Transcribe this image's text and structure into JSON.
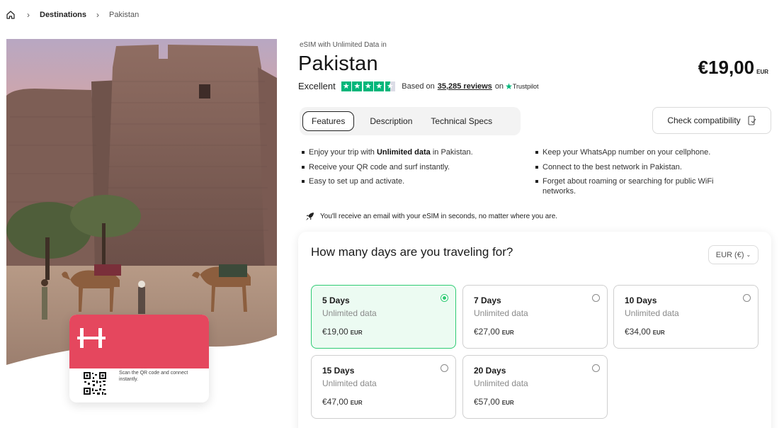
{
  "breadcrumb": {
    "home_icon": "home-icon",
    "items": [
      "Destinations",
      "Pakistan"
    ]
  },
  "product": {
    "subtitle": "eSIM with Unlimited Data in",
    "title": "Pakistan",
    "price": "€19,00",
    "price_currency": "EUR"
  },
  "rating": {
    "label": "Excellent",
    "stars": 4.5,
    "based_on": "Based on",
    "reviews": "35,285 reviews",
    "on": "on",
    "provider": "Trustpilot"
  },
  "tabs": [
    {
      "label": "Features",
      "active": true
    },
    {
      "label": "Description",
      "active": false
    },
    {
      "label": "Technical Specs",
      "active": false
    }
  ],
  "compat": {
    "label": "Check compatibility",
    "icon": "phone-check-icon"
  },
  "features": {
    "left": [
      {
        "pre": "Enjoy your trip with ",
        "bold": "Unlimited data",
        "post": " in Pakistan."
      },
      {
        "pre": "Receive your QR code and surf instantly.",
        "bold": "",
        "post": ""
      },
      {
        "pre": "Easy to set up and activate.",
        "bold": "",
        "post": ""
      }
    ],
    "right": [
      "Keep your WhatsApp number on your cellphone.",
      "Connect to the best network in Pakistan.",
      "Forget about roaming or searching for public WiFi networks."
    ]
  },
  "email_note": "You'll receive an email with your eSIM in seconds, no matter where you are.",
  "days": {
    "question": "How many days are you traveling for?",
    "currency_select": "EUR (€)",
    "options": [
      {
        "name": "5 Days",
        "data": "Unlimited data",
        "price": "€19,00",
        "currency": "EUR",
        "selected": true
      },
      {
        "name": "7 Days",
        "data": "Unlimited data",
        "price": "€27,00",
        "currency": "EUR",
        "selected": false
      },
      {
        "name": "10 Days",
        "data": "Unlimited data",
        "price": "€34,00",
        "currency": "EUR",
        "selected": false
      },
      {
        "name": "15 Days",
        "data": "Unlimited data",
        "price": "€47,00",
        "currency": "EUR",
        "selected": false
      },
      {
        "name": "20 Days",
        "data": "Unlimited data",
        "price": "€57,00",
        "currency": "EUR",
        "selected": false
      }
    ]
  },
  "esim_card": {
    "brand_color": "#e5475e",
    "scan_text": "Scan the QR code and connect instantly."
  },
  "colors": {
    "accent_green": "#2ecb73",
    "trustpilot_green": "#00b67a"
  }
}
